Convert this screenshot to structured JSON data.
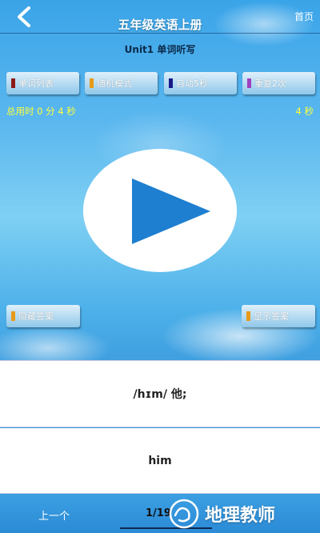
{
  "header": {
    "title": "五年级英语上册",
    "home_label": "首页",
    "back_icon": "chevron-left-icon"
  },
  "subtitle": "Unit1 单词听写",
  "buttons": [
    {
      "label": "单词列表",
      "swatch": "#8b1a1a"
    },
    {
      "label": "随机模式",
      "swatch": "#e89a1a"
    },
    {
      "label": "自动5秒",
      "swatch": "#1a1a8b"
    },
    {
      "label": "重复2次",
      "swatch": "#a040c0"
    }
  ],
  "timer": {
    "elapsed_label": "总用时 0 分 4 秒",
    "countdown_label": "4 秒"
  },
  "answer_buttons": {
    "hide_label": "隐藏答案",
    "show_label": "显示答案",
    "swatch": "#e89a1a"
  },
  "card": {
    "phonetic": "/hɪm/ 他;",
    "word": "him"
  },
  "footer": {
    "prev_label": "上一个",
    "page_label": "1/19"
  },
  "watermark": {
    "text": "地理教师"
  },
  "colors": {
    "accent": "#2f9be0",
    "timer_text": "#ffff3a",
    "play_triangle": "#1e7fd0"
  }
}
